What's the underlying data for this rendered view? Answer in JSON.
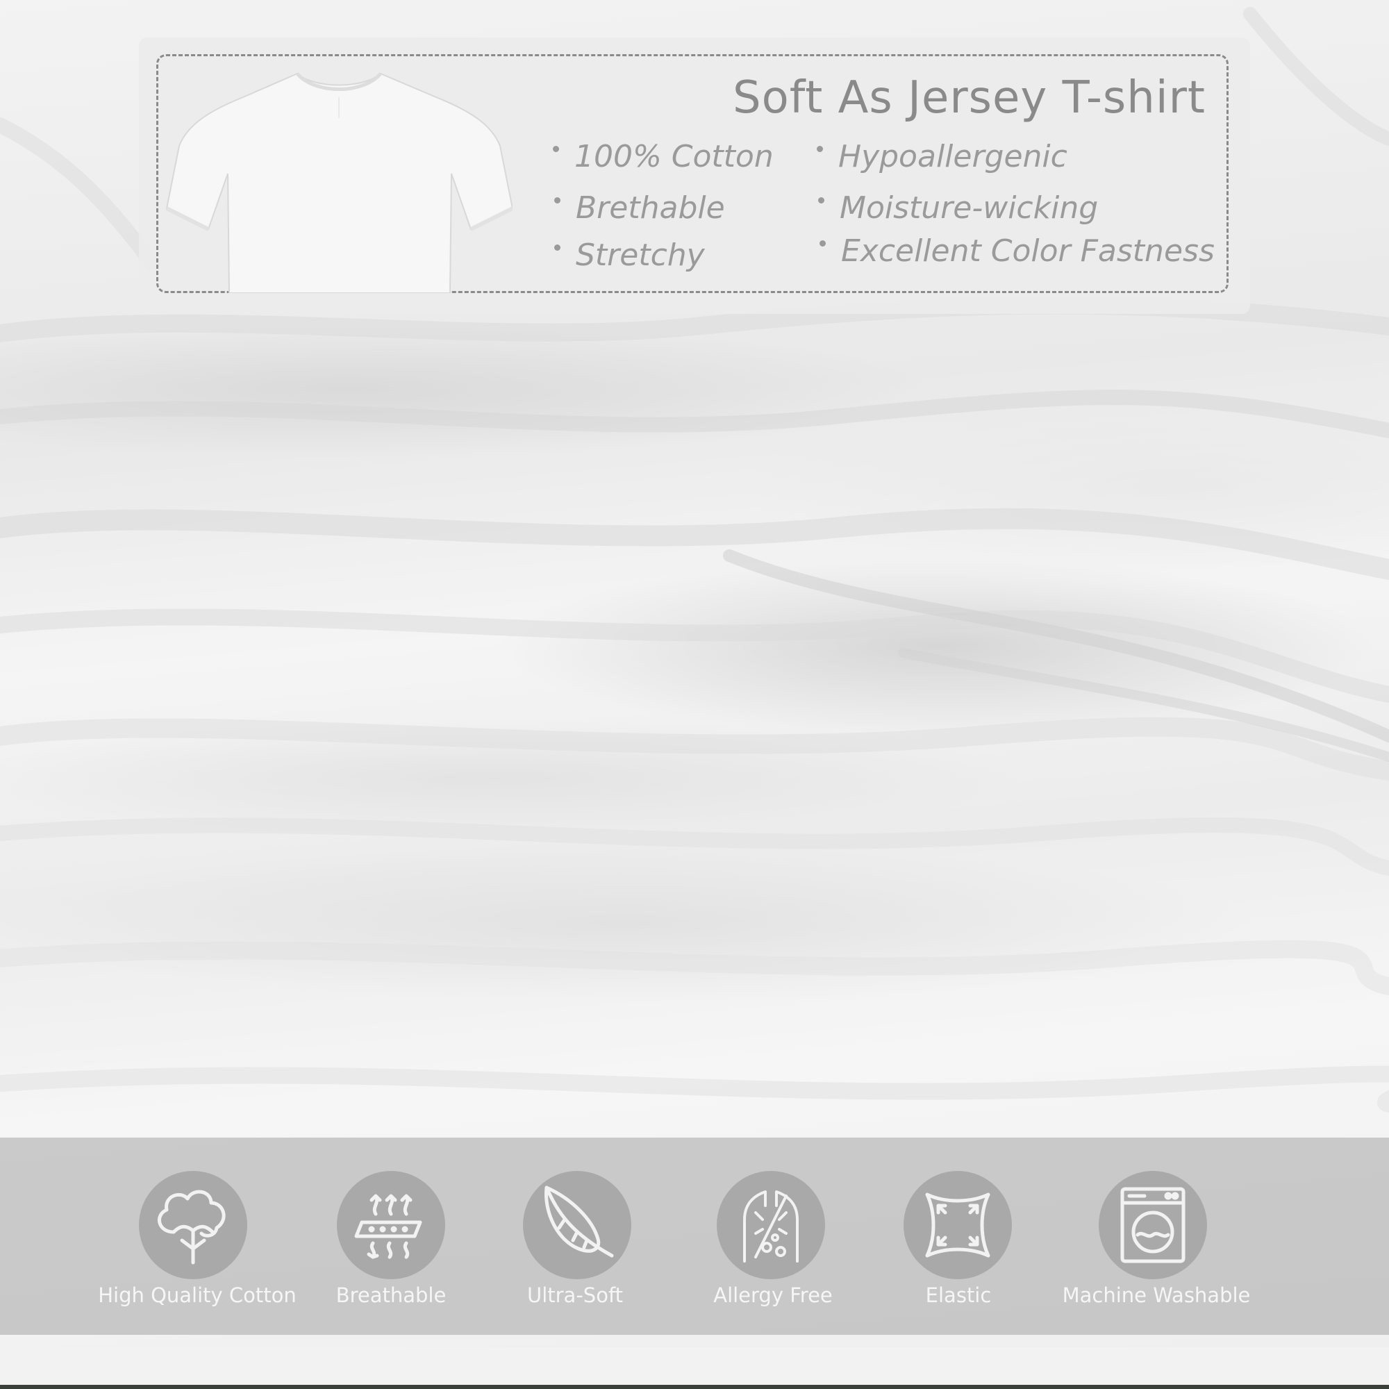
{
  "card": {
    "title": "Soft As Jersey T-shirt",
    "features_left": [
      "100% Cotton",
      "Brethable",
      "Stretchy"
    ],
    "features_right": [
      "Hypoallergenic",
      "Moisture-wicking",
      "Excellent Color Fastness"
    ]
  },
  "badges": [
    {
      "icon": "cotton-boll-icon",
      "label": "High Quality Cotton"
    },
    {
      "icon": "breathable-layers-icon",
      "label": "Breathable"
    },
    {
      "icon": "feather-icon",
      "label": "Ultra-Soft"
    },
    {
      "icon": "allergy-free-icon",
      "label": "Allergy Free"
    },
    {
      "icon": "stretch-fabric-icon",
      "label": "Elastic"
    },
    {
      "icon": "washing-machine-icon",
      "label": "Machine Washable"
    }
  ],
  "colors": {
    "card_background": "#ececec",
    "card_text": "#8a8a8a",
    "band_background": "#afafaf",
    "badge_circle": "#a9a9a9",
    "badge_label": "#f6f6f6"
  }
}
